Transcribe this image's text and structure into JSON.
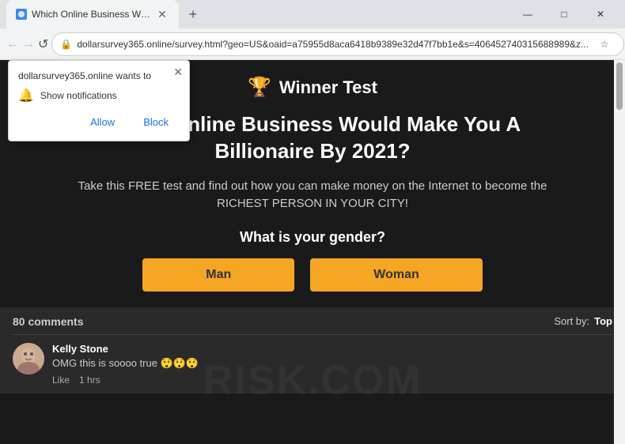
{
  "browser": {
    "tab": {
      "title": "Which Online Business Would M",
      "favicon_char": "🌐"
    },
    "address": "dollarsurvey365.online/survey.html?geo=US&oaid=a75955d8aca6418b9389e32d47f7bb1e&s=406452740315688989&z...",
    "new_tab_label": "+",
    "nav": {
      "back": "←",
      "forward": "→",
      "refresh": "↺"
    },
    "window_controls": {
      "minimize": "—",
      "maximize": "□",
      "close": "✕"
    }
  },
  "notification": {
    "site": "dollarsurvey365.online wants to",
    "description": "Show notifications",
    "allow_label": "Allow",
    "block_label": "Block",
    "close_char": "✕"
  },
  "page": {
    "winner_label": "Winner Test",
    "headline": "Which Online Business Would Make You A Billionaire By 2021?",
    "subtext": "Take this FREE test and find out how you can make money on the Internet to become the RICHEST PERSON IN YOUR CITY!",
    "gender_question": "What is your gender?",
    "gender_man": "Man",
    "gender_woman": "Woman",
    "watermark": "RISK.COM"
  },
  "comments": {
    "count_label": "80 comments",
    "sort_label": "Sort by:",
    "sort_value": "Top",
    "items": [
      {
        "name": "Kelly Stone",
        "text": "OMG this is soooo true 😲😲😲",
        "like_label": "Like",
        "time": "1 hrs"
      }
    ]
  }
}
